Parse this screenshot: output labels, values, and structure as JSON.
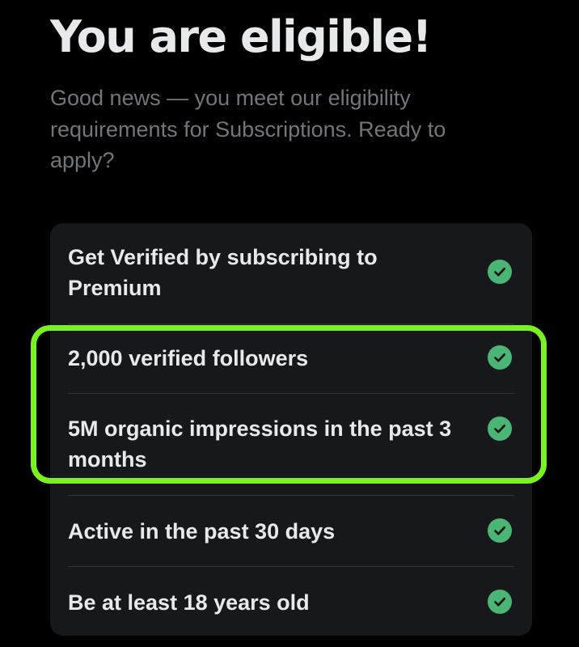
{
  "header": {
    "title": "You are eligible!",
    "subtitle": "Good news — you meet our eligibility requirements for Subscriptions. Ready to apply?"
  },
  "requirements": [
    {
      "label": "Get Verified by subscribing to Premium",
      "met": true,
      "icon": "check-circle-icon"
    },
    {
      "label": "2,000 verified followers",
      "met": true,
      "icon": "check-circle-icon"
    },
    {
      "label": "5M organic impressions in the past 3 months",
      "met": true,
      "icon": "check-circle-icon"
    },
    {
      "label": "Active in the past 30 days",
      "met": true,
      "icon": "check-circle-icon"
    },
    {
      "label": "Be at least 18 years old",
      "met": true,
      "icon": "check-circle-icon"
    }
  ],
  "colors": {
    "background": "#000000",
    "card": "#16181c",
    "text_primary": "#e7e9ea",
    "text_secondary": "#71767b",
    "check": "#4ab574",
    "highlight": "#79f21f"
  }
}
